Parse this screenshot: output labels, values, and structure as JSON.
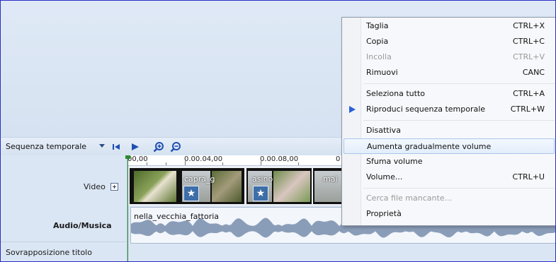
{
  "timeline": {
    "label": "Sequenza temporale",
    "ruler": [
      "00,00",
      "0.00.04,00",
      "0.00.08,00",
      "0"
    ]
  },
  "tracks": {
    "video": "Video",
    "audio": "Audio/Musica",
    "title_overlay": "Sovrapposizione titolo"
  },
  "clips": [
    {
      "name": ""
    },
    {
      "name": "capra_g"
    },
    {
      "name": "asino"
    },
    {
      "name": "mai"
    }
  ],
  "audio_clip": {
    "name": "nella_vecchia_fattoria"
  },
  "menu": {
    "items": [
      {
        "label": "Taglia",
        "shortcut": "CTRL+X",
        "enabled": true
      },
      {
        "label": "Copia",
        "shortcut": "CTRL+C",
        "enabled": true
      },
      {
        "label": "Incolla",
        "shortcut": "CTRL+V",
        "enabled": false
      },
      {
        "label": "Rimuovi",
        "shortcut": "CANC",
        "enabled": true
      },
      {
        "label": "Seleziona tutto",
        "shortcut": "CTRL+A",
        "enabled": true
      },
      {
        "label": "Riproduci sequenza temporale",
        "shortcut": "CTRL+W",
        "enabled": true
      },
      {
        "label": "Disattiva",
        "shortcut": "",
        "enabled": true
      },
      {
        "label": "Aumenta gradualmente volume",
        "shortcut": "",
        "enabled": true
      },
      {
        "label": "Sfuma volume",
        "shortcut": "",
        "enabled": true
      },
      {
        "label": "Volume...",
        "shortcut": "CTRL+U",
        "enabled": true
      },
      {
        "label": "Cerca file mancante...",
        "shortcut": "",
        "enabled": false
      },
      {
        "label": "Proprietà",
        "shortcut": "",
        "enabled": true
      }
    ]
  },
  "colors": {
    "frame_border": "#2a2dc8",
    "toolbar_icon": "#1e4fb0",
    "play_arrow": "#2a5fd8",
    "playhead": "#2d8a2d"
  }
}
